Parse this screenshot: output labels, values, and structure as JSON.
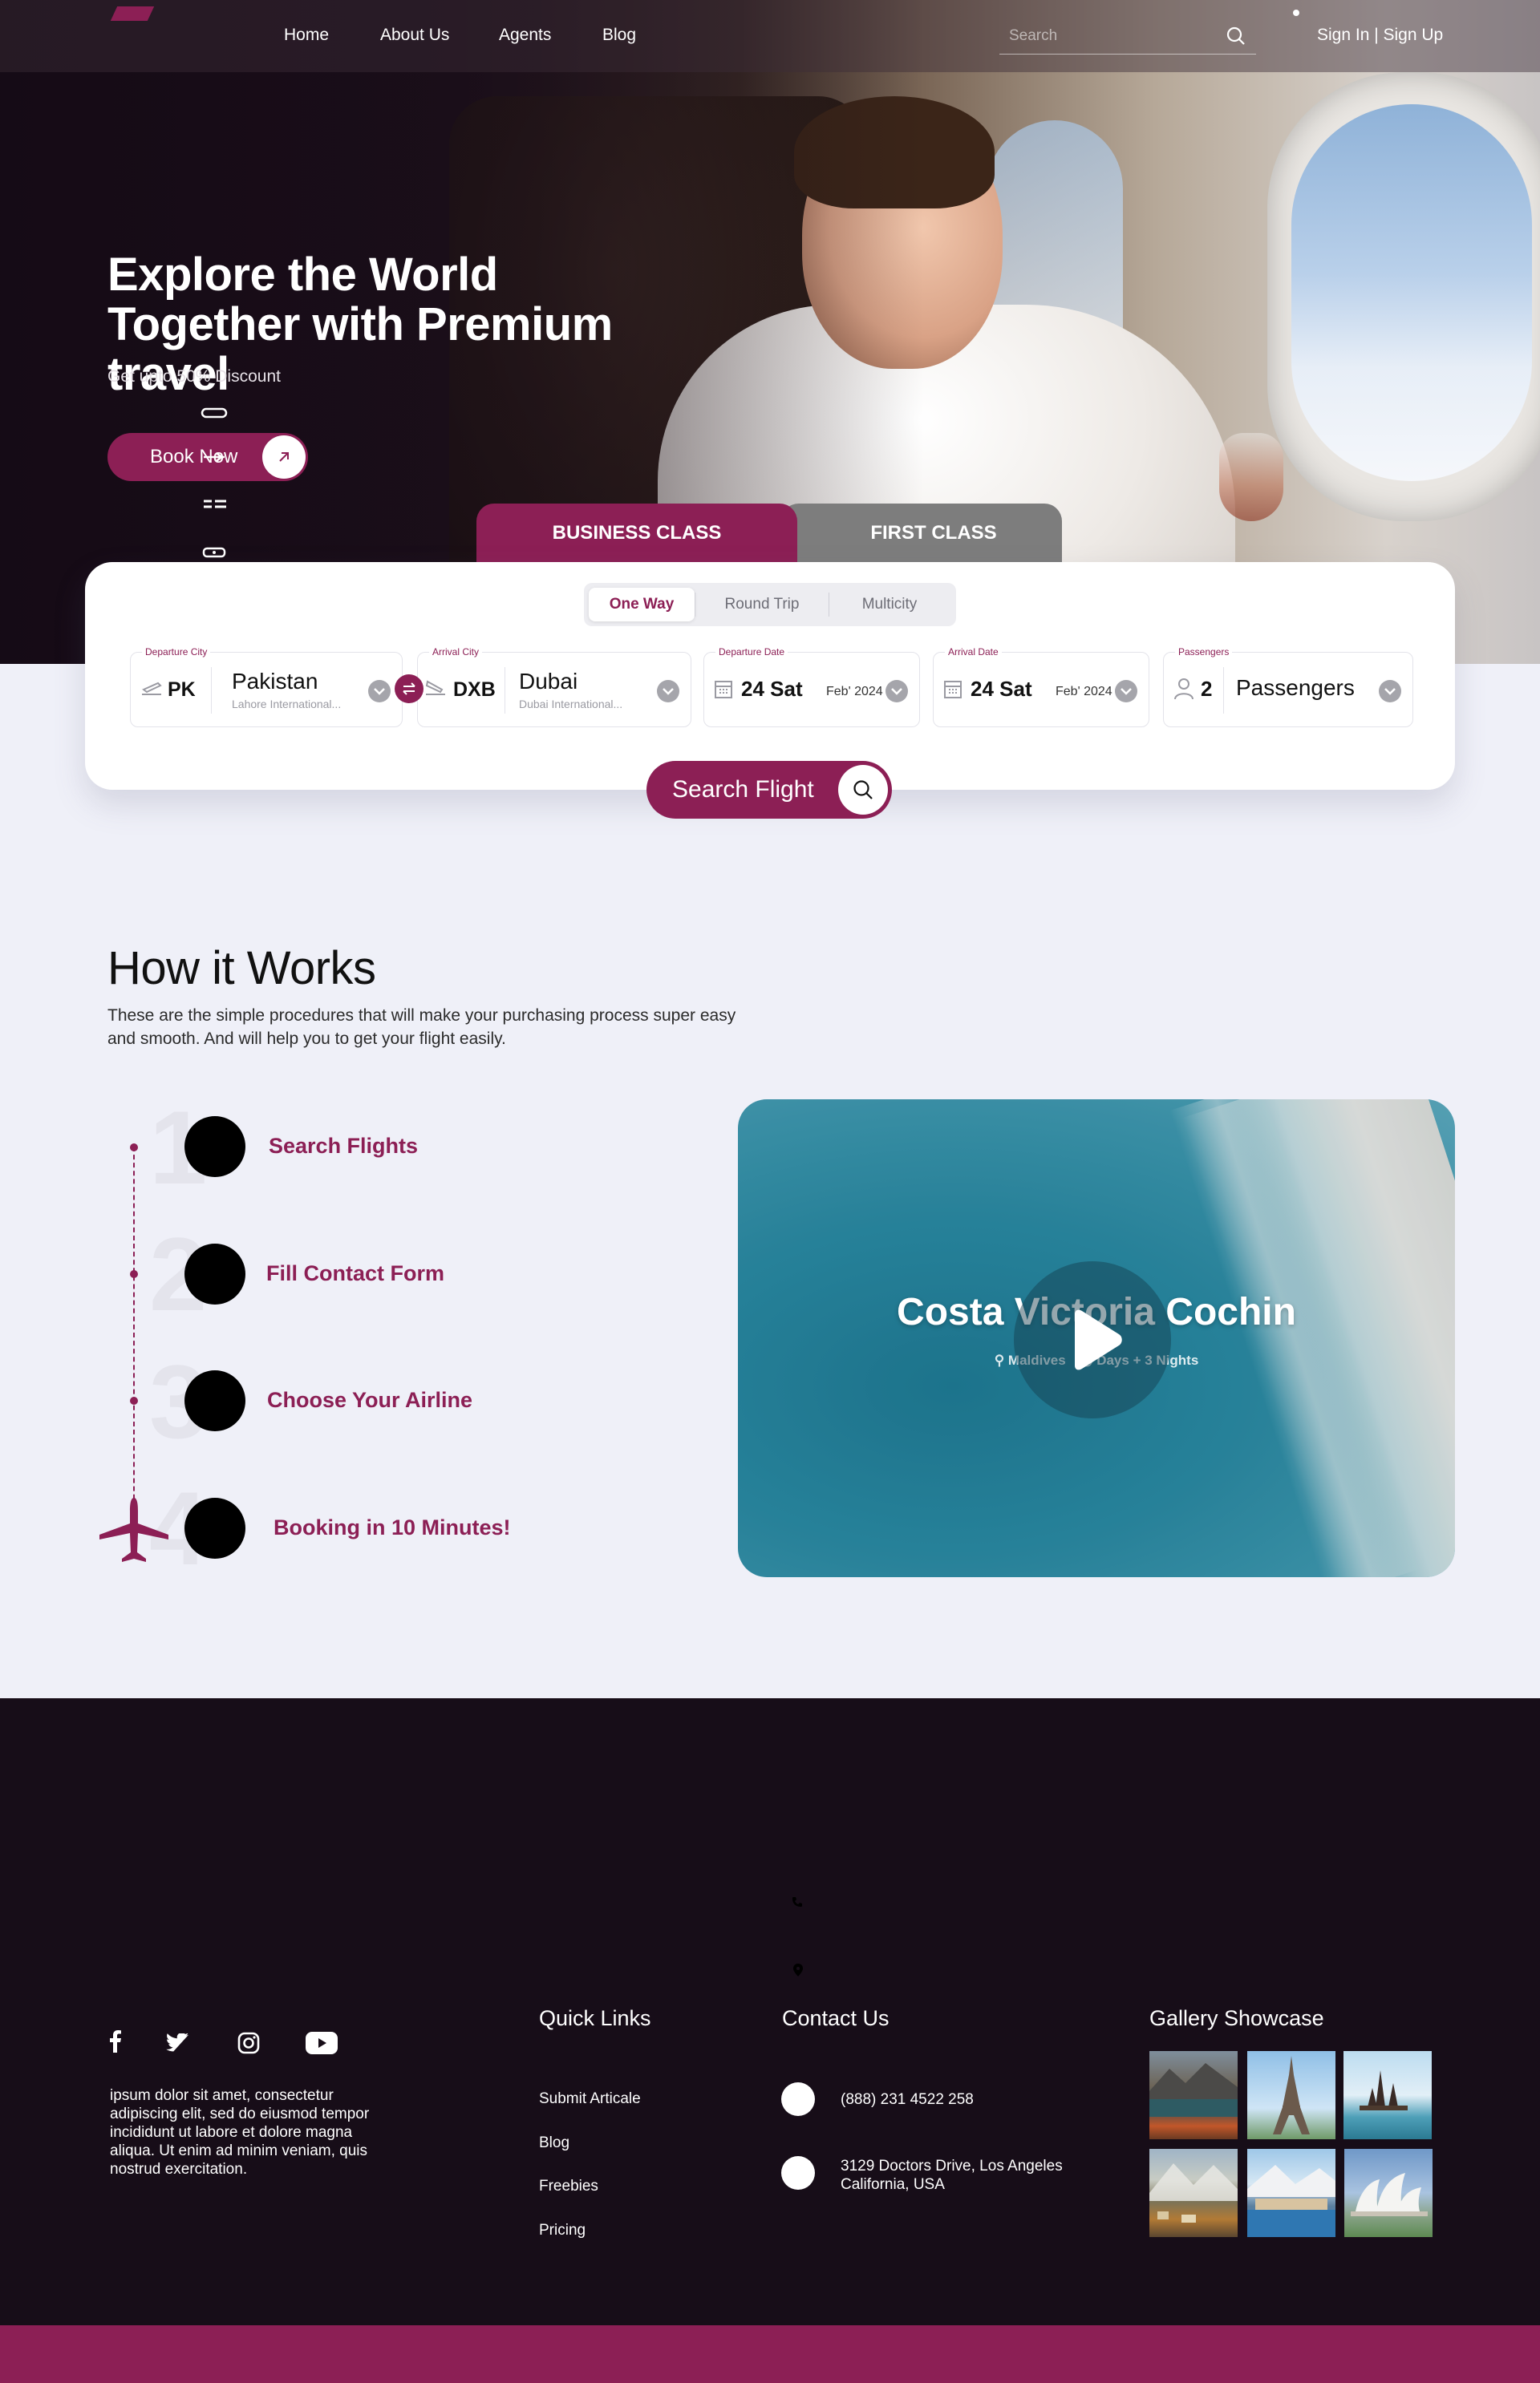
{
  "nav": {
    "links": [
      "Home",
      "About Us",
      "Agents",
      "Blog"
    ],
    "search_placeholder": "Search",
    "auth": "Sign In | Sign Up"
  },
  "hero": {
    "title": "Explore the World Together with Premium travel",
    "subtitle": "Get upto 50% Discount",
    "cta": "Book Now"
  },
  "booking": {
    "tabs": [
      "BUSINESS CLASS",
      "FIRST CLASS"
    ],
    "active_tab": "BUSINESS CLASS",
    "trip_types": [
      "One Way",
      "Round Trip",
      "Multicity"
    ],
    "active_trip": "One Way",
    "departure": {
      "label": "Departure City",
      "code": "PK",
      "city": "Pakistan",
      "airport": "Lahore International..."
    },
    "arrival": {
      "label": "Arrival City",
      "code": "DXB",
      "city": "Dubai",
      "airport": "Dubai International..."
    },
    "departure_date": {
      "label": "Departure Date",
      "day": "24 Sat",
      "month": "Feb' 2024"
    },
    "arrival_date": {
      "label": "Arrival Date",
      "day": "24 Sat",
      "month": "Feb' 2024"
    },
    "passengers": {
      "label": "Passengers",
      "count": "2",
      "text": "Passengers"
    },
    "search_button": "Search Flight"
  },
  "how": {
    "title": "How it Works",
    "description": "These are the simple procedures that will make your purchasing process super easy and smooth. And will help you to get your flight easily.",
    "steps": [
      {
        "num": "1",
        "label": "Search Flights"
      },
      {
        "num": "2",
        "label": "Fill Contact Form"
      },
      {
        "num": "3",
        "label": "Choose Your Airline"
      },
      {
        "num": "4",
        "label": "Booking in 10 Minutes!"
      }
    ],
    "video": {
      "title": "Costa Victoria Cochin",
      "location": "Maldives",
      "duration": "Days + 3 Nights"
    }
  },
  "footer": {
    "about": "ipsum dolor sit amet, consectetur adipiscing elit, sed do eiusmod tempor incididunt ut labore et dolore magna aliqua. Ut enim ad minim veniam, quis nostrud exercitation.",
    "quick_links_title": "Quick Links",
    "quick_links": [
      "Submit Articale",
      "Blog",
      "Freebies",
      "Pricing"
    ],
    "contact_title": "Contact Us",
    "phone": "(888) 231 4522 258",
    "address_line1": "3129 Doctors Drive, Los Angeles",
    "address_line2": "California, USA",
    "gallery_title": "Gallery Showcase",
    "gallery": [
      "lake-mountains-photo",
      "eiffel-tower-photo",
      "temple-lake-photo",
      "village-mountains-photo",
      "harbor-town-photo",
      "opera-house-photo"
    ]
  },
  "colors": {
    "brand": "#8c1f55",
    "footer_bg": "#170d18",
    "page_bg": "#eff0f8"
  }
}
